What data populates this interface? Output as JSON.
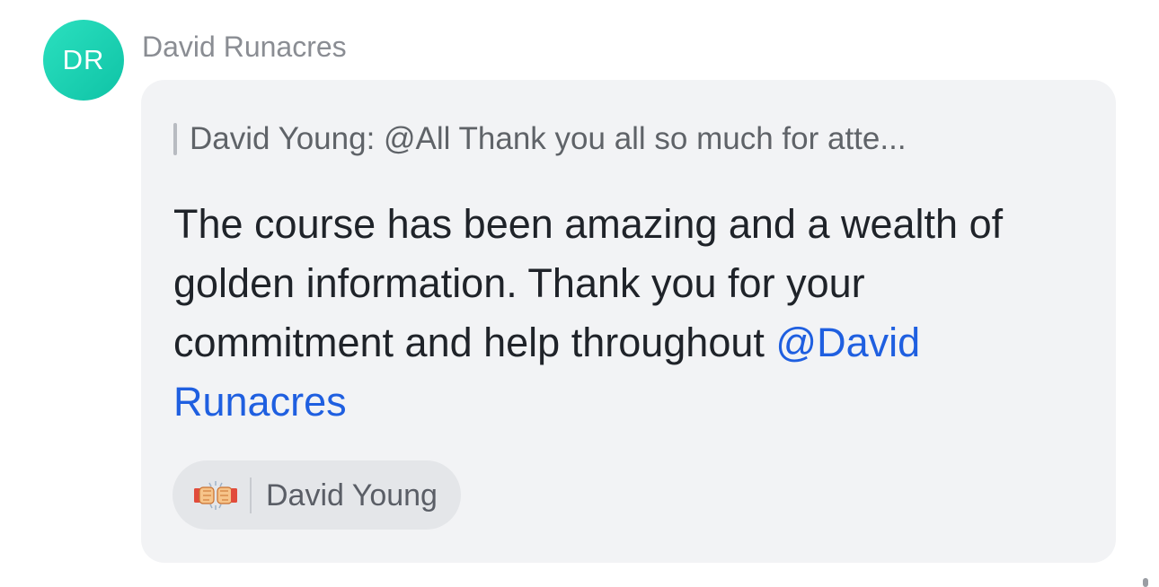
{
  "message": {
    "avatar_initials": "DR",
    "avatar_color": "#12cfad",
    "sender_name": "David Runacres",
    "quote": {
      "text": "David Young: @All Thank you all so much for atte..."
    },
    "body": {
      "text": "The course has been amazing and a wealth of golden information. Thank you for your commitment and help throughout ",
      "mention": "@David Runacres",
      "mention_color": "#1f5fe0"
    },
    "reaction": {
      "emoji_icon": "fist-bump-icon",
      "user": "David Young"
    }
  }
}
